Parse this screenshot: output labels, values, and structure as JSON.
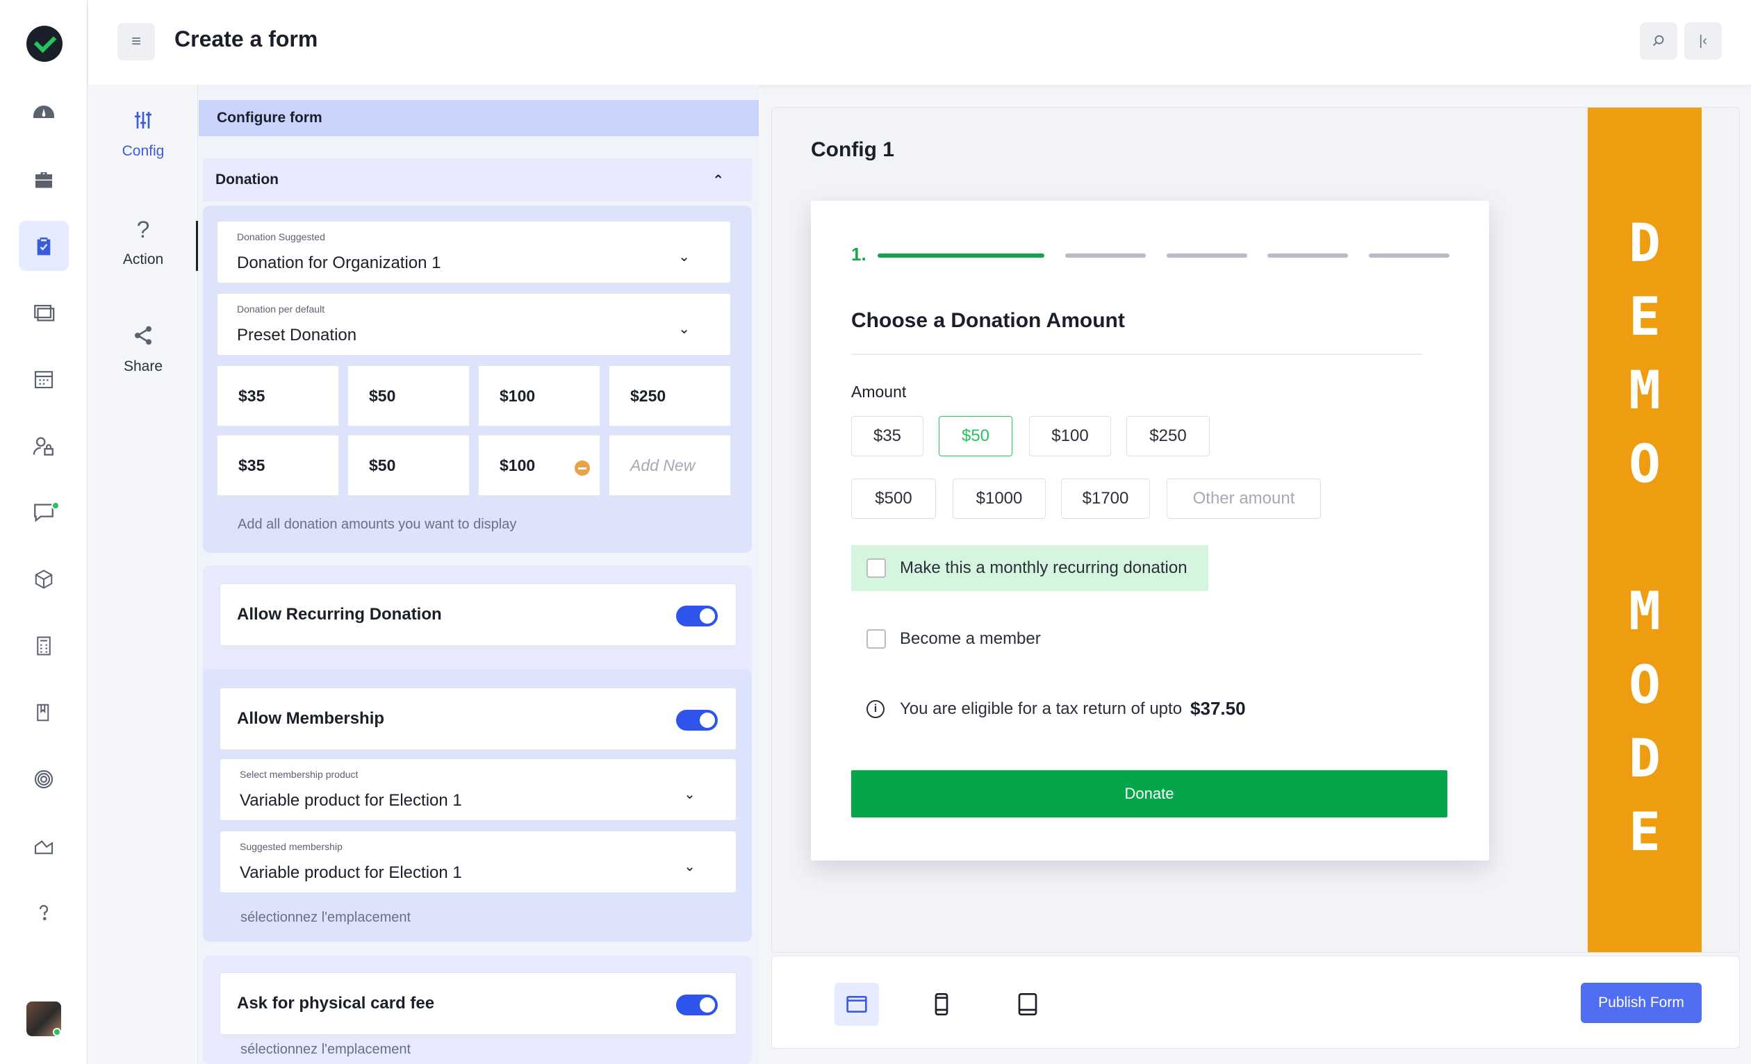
{
  "app": {
    "page_title": "Create a form"
  },
  "rail": {
    "icons": [
      "dashboard-icon",
      "briefcase-icon",
      "clipboard-check-icon",
      "layers-icon",
      "calendar-icon",
      "user-lock-icon",
      "chat-icon",
      "box-icon",
      "calculator-icon",
      "book-icon",
      "target-icon",
      "chart-icon",
      "help-icon"
    ],
    "active": "clipboard-check-icon"
  },
  "subnav": {
    "items": [
      {
        "label": "Config",
        "icon": "sliders-icon",
        "active": true
      },
      {
        "label": "Action",
        "icon": "question-icon",
        "active": false
      },
      {
        "label": "Share",
        "icon": "share-icon",
        "active": false
      }
    ]
  },
  "config": {
    "header": "Configure form",
    "section": "Donation",
    "donation_suggested": {
      "label": "Donation Suggested",
      "value": "Donation for Organization 1"
    },
    "donation_default": {
      "label": "Donation per default",
      "value": "Preset Donation"
    },
    "preset_amounts": [
      "$35",
      "$50",
      "$100",
      "$250"
    ],
    "custom_amounts": [
      "$35",
      "$50",
      "$100"
    ],
    "add_new": "Add New",
    "amounts_hint": "Add all donation amounts you want to display",
    "recurring": {
      "label": "Allow Recurring Donation",
      "enabled": true
    },
    "membership": {
      "label": "Allow Membership",
      "enabled": true
    },
    "membership_product": {
      "label": "Select membership product",
      "value": "Variable product for Election 1"
    },
    "suggested_membership": {
      "label": "Suggested membership",
      "value": "Variable product for Election 1"
    },
    "membership_hint": "sélectionnez l'emplacement",
    "card_fee": {
      "label": "Ask for physical card fee",
      "enabled": true
    },
    "card_fee_hint": "sélectionnez l'emplacement"
  },
  "preview": {
    "title": "Config 1",
    "demo_letters": [
      "D",
      "E",
      "M",
      "O",
      "M",
      "O",
      "D",
      "E"
    ],
    "step": "1.",
    "heading": "Choose a Donation Amount",
    "amount_label": "Amount",
    "amounts_row1": [
      "$35",
      "$50",
      "$100",
      "$250"
    ],
    "amounts_row2": [
      "$500",
      "$1000",
      "$1700"
    ],
    "selected_amount": "$50",
    "other_amount": "Other amount",
    "monthly": "Make this a monthly recurring donation",
    "member": "Become a member",
    "tax_text": "You are eligible for a tax return of upto",
    "tax_amount": "$37.50",
    "donate": "Donate",
    "colors": {
      "accent": "#05a64a",
      "demo": "#ee9c10",
      "brand": "#4f6ef2"
    }
  },
  "device_bar": {
    "devices": [
      "desktop-icon",
      "mobile-icon",
      "tablet-icon"
    ],
    "active": "desktop-icon",
    "publish": "Publish Form"
  }
}
